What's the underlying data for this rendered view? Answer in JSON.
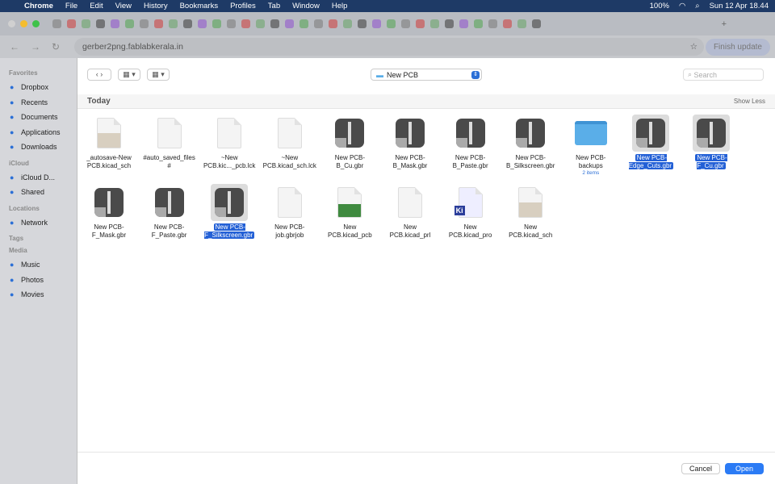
{
  "menubar": {
    "app": "Chrome",
    "items": [
      "File",
      "Edit",
      "View",
      "History",
      "Bookmarks",
      "Profiles",
      "Tab",
      "Window",
      "Help"
    ],
    "battery": "100%",
    "clock": "Sun 12 Apr  18.44"
  },
  "browser": {
    "url": "gerber2png.fablabkerala.in",
    "finish_update": "Finish update"
  },
  "sidebar": {
    "sections": [
      {
        "title": "Favorites",
        "items": [
          {
            "label": "Dropbox",
            "icon": "dropbox-icon"
          },
          {
            "label": "Recents",
            "icon": "clock-icon"
          },
          {
            "label": "Documents",
            "icon": "document-icon"
          },
          {
            "label": "Applications",
            "icon": "applications-icon"
          },
          {
            "label": "Downloads",
            "icon": "download-icon"
          }
        ]
      },
      {
        "title": "iCloud",
        "items": [
          {
            "label": "iCloud D...",
            "icon": "cloud-icon"
          },
          {
            "label": "Shared",
            "icon": "shared-folder-icon"
          }
        ]
      },
      {
        "title": "Locations",
        "items": [
          {
            "label": "Network",
            "icon": "globe-icon"
          }
        ]
      },
      {
        "title": "Tags",
        "items": []
      },
      {
        "title": "Media",
        "items": [
          {
            "label": "Music",
            "icon": "music-icon"
          },
          {
            "label": "Photos",
            "icon": "photos-icon"
          },
          {
            "label": "Movies",
            "icon": "movies-icon"
          }
        ]
      }
    ]
  },
  "dialog": {
    "location": "New PCB",
    "search_placeholder": "Search",
    "group": "Today",
    "show_less": "Show Less",
    "cancel": "Cancel",
    "open": "Open",
    "files": [
      {
        "name": "_autosave-New\nPCB.kicad_sch",
        "type": "kicad-sch"
      },
      {
        "name": "#auto_saved_files\n#",
        "type": "doc"
      },
      {
        "name": "~New\nPCB.kic..._pcb.lck",
        "type": "doc"
      },
      {
        "name": "~New\nPCB.kicad_sch.lck",
        "type": "doc"
      },
      {
        "name": "New PCB-\nB_Cu.gbr",
        "type": "gbr"
      },
      {
        "name": "New PCB-\nB_Mask.gbr",
        "type": "gbr"
      },
      {
        "name": "New PCB-\nB_Paste.gbr",
        "type": "gbr"
      },
      {
        "name": "New PCB-\nB_Silkscreen.gbr",
        "type": "gbr"
      },
      {
        "name": "New PCB-\nbackups",
        "type": "folder",
        "sub": "2 items"
      },
      {
        "name": "New PCB-\nEdge_Cuts.gbr",
        "type": "gbr",
        "selected": true
      },
      {
        "name": "New PCB-\nF_Cu.gbr",
        "type": "gbr",
        "selected": true
      },
      {
        "name": "New PCB-\nF_Mask.gbr",
        "type": "gbr"
      },
      {
        "name": "New PCB-\nF_Paste.gbr",
        "type": "gbr"
      },
      {
        "name": "New PCB-\nF_Silkscreen.gbr",
        "type": "gbr",
        "selected": true
      },
      {
        "name": "New PCB-\njob.gbrjob",
        "type": "doc"
      },
      {
        "name": "New\nPCB.kicad_pcb",
        "type": "kicad-pcb"
      },
      {
        "name": "New\nPCB.kicad_prl",
        "type": "doc"
      },
      {
        "name": "New\nPCB.kicad_pro",
        "type": "kicad-pro"
      },
      {
        "name": "New\nPCB.kicad_sch",
        "type": "kicad-sch"
      }
    ]
  }
}
